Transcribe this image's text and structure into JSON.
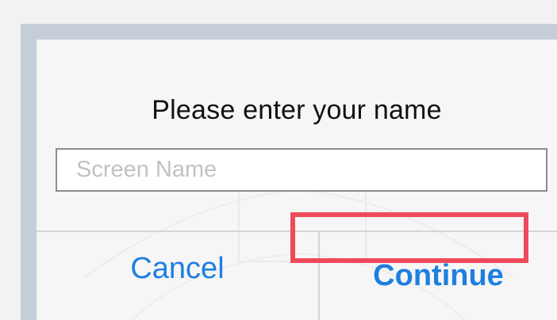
{
  "dialog": {
    "title": "Please enter your name",
    "input": {
      "placeholder": "Screen Name",
      "value": ""
    },
    "buttons": {
      "cancel_label": "Cancel",
      "continue_label": "Continue"
    }
  },
  "colors": {
    "background": "#f2f2f2",
    "frame": "#c5ced8",
    "dialog": "#f6f6f6",
    "button_text": "#1e7fe0",
    "highlight": "#ef4a5a"
  }
}
